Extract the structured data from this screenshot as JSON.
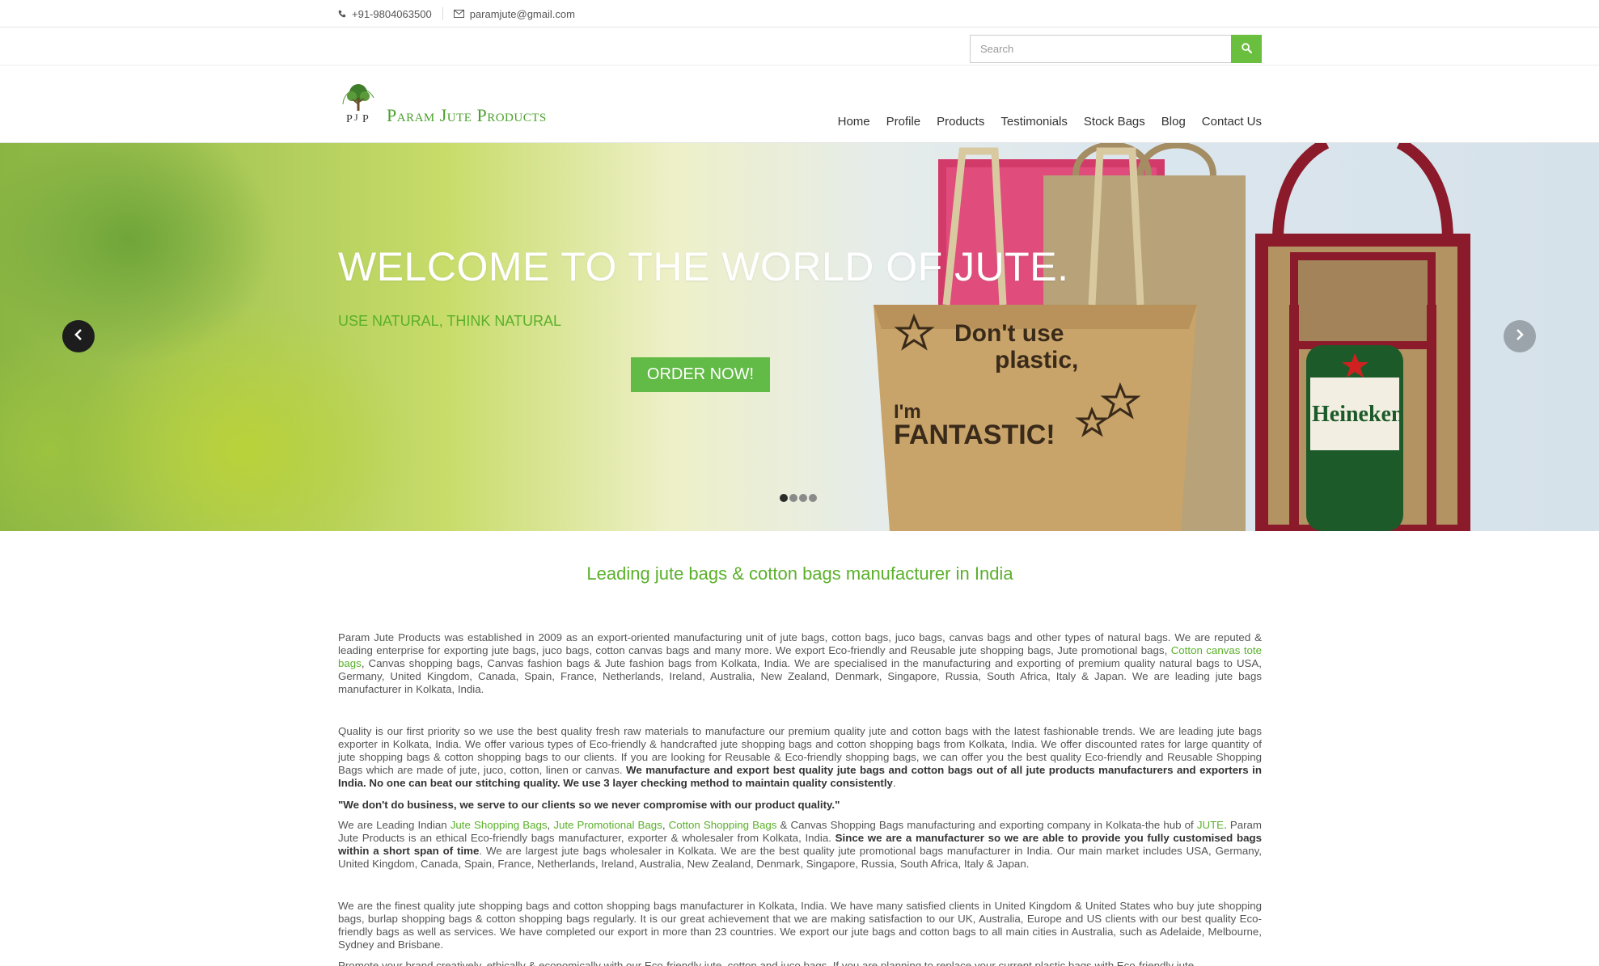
{
  "topbar": {
    "phone": "+91-9804063500",
    "email": "paramjute@gmail.com"
  },
  "search": {
    "placeholder": "Search"
  },
  "logo": {
    "text": "Param Jute Products"
  },
  "nav": [
    "Home",
    "Profile",
    "Products",
    "Testimonials",
    "Stock Bags",
    "Blog",
    "Contact Us"
  ],
  "hero": {
    "title": "WELCOME TO THE WORLD OF JUTE.",
    "subtitle": "USE NATURAL, THINK NATURAL",
    "cta": "ORDER NOW!",
    "bag1_line1": "Don't use",
    "bag1_line2": "plastic,",
    "bag1_line3": "I'm",
    "bag1_line4": "FANTASTIC!",
    "bottle_label": "Heineken",
    "slides": 4,
    "active_slide": 1
  },
  "content": {
    "heading": "Leading jute bags & cotton bags manufacturer in India",
    "p1a": "Param Jute Products was established in 2009 as an export-oriented manufacturing unit of jute bags, cotton bags, juco bags, canvas bags and other types of natural bags. We are reputed & leading enterprise for exporting jute bags, juco bags, cotton canvas bags and many more. We export Eco-friendly and Reusable jute shopping bags, Jute promotional bags, ",
    "p1link": "Cotton canvas tote bags",
    "p1b": ", Canvas shopping bags, Canvas fashion bags & Jute fashion bags from Kolkata, India. We are specialised in the manufacturing and exporting of premium quality natural bags to USA, Germany, United Kingdom, Canada, Spain, France, Netherlands, Ireland, Australia, New Zealand, Denmark, Singapore, Russia, South Africa, Italy & Japan. We are leading jute bags manufacturer in Kolkata, India.",
    "p2a": "Quality is our first priority so we use the best quality fresh raw materials to manufacture our premium quality jute and cotton bags with the latest fashionable trends. We are leading jute bags exporter in Kolkata, India. We offer various types of Eco-friendly & handcrafted jute shopping bags and cotton shopping bags from Kolkata, India. We offer discounted rates for large quantity of jute shopping bags & cotton shopping bags to our clients. If you are looking for Reusable & Eco-friendly shopping bags, we can offer you the best quality Eco-friendly and Reusable Shopping Bags which are made of jute, juco, cotton, linen or canvas. ",
    "p2bold": "We manufacture and export best quality jute bags and cotton bags out of all jute products manufacturers and exporters in India. No one can beat our stitching quality. We use 3 layer checking method to maintain quality consistently",
    "p2end": ".",
    "quote": "\"We don't do business, we serve to our clients so we never compromise with our product quality.\"",
    "p3a": "We are Leading Indian ",
    "p3link1": "Jute Shopping Bags",
    "p3c1": ", ",
    "p3link2": "Jute Promotional Bags",
    "p3c2": ", ",
    "p3link3": "Cotton Shopping Bags",
    "p3b": " & Canvas Shopping Bags manufacturing and exporting company in Kolkata-the hub of ",
    "p3link4": "JUTE",
    "p3c": ". Param Jute Products is an ethical Eco-friendly bags manufacturer, exporter & wholesaler from Kolkata, India. ",
    "p3bold": "Since we are a manufacturer so we are able to provide you fully customised bags within a short span of time",
    "p3d": ". We are largest jute bags wholesaler in Kolkata. We are the best quality jute promotional bags manufacturer in India. Our main market includes USA, Germany, United Kingdom, Canada, Spain, France, Netherlands, Ireland, Australia, New Zealand, Denmark, Singapore, Russia, South Africa, Italy & Japan.",
    "p4": "We are the finest quality jute shopping bags and cotton shopping bags manufacturer in Kolkata, India. We have many satisfied clients in United Kingdom & United States who buy jute shopping bags, burlap shopping bags & cotton shopping bags regularly. It is our great achievement that we are making satisfaction to our UK, Australia, Europe and US clients with our best quality Eco-friendly bags as well as services. We have completed our export in more than 23 countries. We export our jute bags and cotton bags to all main cities in Australia, such as Adelaide, Melbourne, Sydney and Brisbane.",
    "p5": "Promote your brand creatively, ethically & economically with our Eco-friendly jute, cotton and juco bags. If you are planning to replace your current plastic bags with Eco-friendly jute"
  },
  "colors": {
    "accent_green": "#5ab02a",
    "button_green": "#62bb46",
    "bag_red": "#8b1a2a"
  }
}
